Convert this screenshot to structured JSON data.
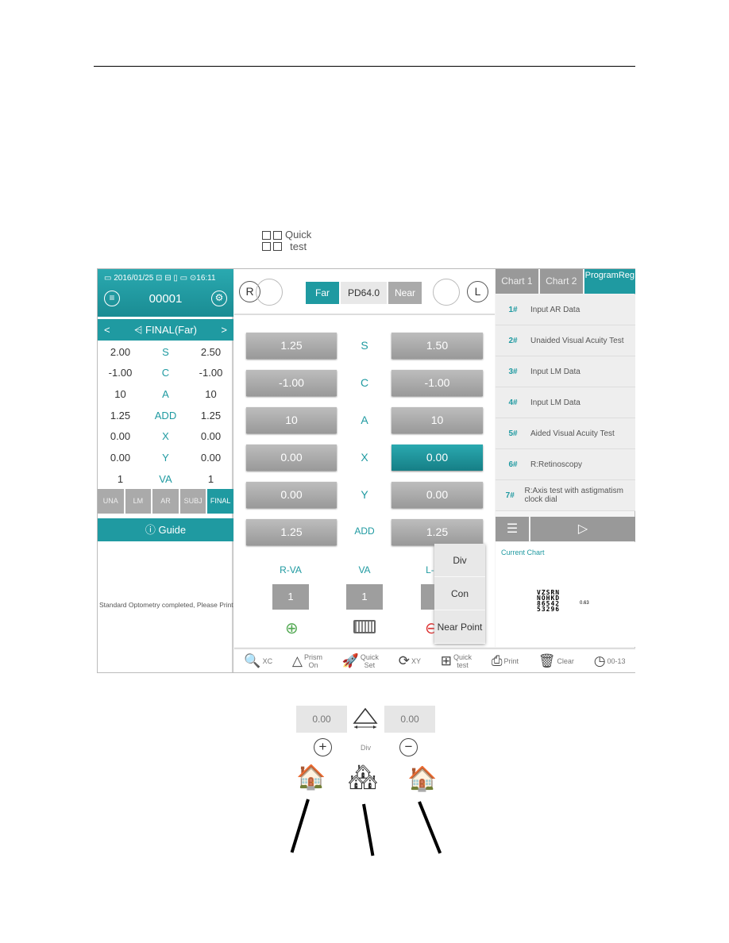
{
  "quick_test_icon": {
    "icon": "quick-test-grid-icon",
    "line1": "Quick",
    "line2": "test"
  },
  "app": {
    "status": "▭ 2016/01/25 ⊡ ⊟ ▯ ▭ ⊙16:11",
    "patient_id": "00001",
    "nav_title": "FINAL(Far)",
    "nav_prev": "<",
    "nav_next": ">",
    "summary": [
      {
        "r": "2.00",
        "label": "S",
        "l": "2.50"
      },
      {
        "r": "-1.00",
        "label": "C",
        "l": "-1.00"
      },
      {
        "r": "10",
        "label": "A",
        "l": "10"
      },
      {
        "r": "1.25",
        "label": "ADD",
        "l": "1.25"
      },
      {
        "r": "0.00",
        "label": "X",
        "l": "0.00"
      },
      {
        "r": "0.00",
        "label": "Y",
        "l": "0.00"
      },
      {
        "r": "1",
        "label": "VA",
        "l": "1"
      }
    ],
    "mode_tabs": [
      "UNA",
      "LM",
      "AR",
      "SUBJ",
      "FINAL"
    ],
    "active_mode": "FINAL",
    "guide": "Guide",
    "message": "Standard Optometry completed, Please Print",
    "top": {
      "r": "R",
      "l": "L",
      "far": "Far",
      "pd": "PD64.0",
      "near": "Near"
    },
    "rows": [
      {
        "r": "1.25",
        "label": "S",
        "l": "1.50"
      },
      {
        "r": "-1.00",
        "label": "C",
        "l": "-1.00"
      },
      {
        "r": "10",
        "label": "A",
        "l": "10"
      },
      {
        "r": "0.00",
        "label": "X",
        "l": "0.00"
      },
      {
        "r": "0.00",
        "label": "Y",
        "l": "0.00"
      },
      {
        "r": "1.25",
        "label": "ADD",
        "l": "1.25"
      }
    ],
    "va": {
      "r_label": "R-VA",
      "label": "VA",
      "l_label": "L-VA",
      "r": "1",
      "both": "1",
      "l": "1"
    },
    "popup": [
      "Div",
      "Con",
      "Near Point"
    ],
    "chart_tabs": [
      "Chart 1",
      "Chart 2",
      "ProgramReg"
    ],
    "program": [
      {
        "n": "1#",
        "t": "Input AR Data"
      },
      {
        "n": "2#",
        "t": "Unaided Visual Acuity Test"
      },
      {
        "n": "3#",
        "t": "Input LM Data"
      },
      {
        "n": "4#",
        "t": "Input LM Data"
      },
      {
        "n": "5#",
        "t": "Aided Visual Acuity Test"
      },
      {
        "n": "6#",
        "t": "R:Retinoscopy"
      },
      {
        "n": "7#",
        "t": "R:Axis test with astigmatism clock dial"
      }
    ],
    "current_chart": "Current Chart",
    "chart_rows": [
      "VZSRN",
      "NOHKD",
      "86542",
      "53296"
    ],
    "chart_value": "0.63",
    "toolbar": [
      {
        "icon": "search-icon",
        "a": "XC",
        "b": ""
      },
      {
        "icon": "prism-icon",
        "a": "Prism",
        "b": "On"
      },
      {
        "icon": "rocket-icon",
        "a": "Quick",
        "b": "Set"
      },
      {
        "icon": "refresh-icon",
        "a": "XY",
        "b": ""
      },
      {
        "icon": "quick-test-grid-icon",
        "a": "Quick",
        "b": "test"
      },
      {
        "icon": "print-icon",
        "a": "Print",
        "b": ""
      },
      {
        "icon": "trash-icon",
        "a": "Clear",
        "b": ""
      },
      {
        "icon": "clock-icon",
        "a": "00-13",
        "b": ""
      }
    ]
  },
  "prism": {
    "left": "0.00",
    "right": "0.00",
    "label": "Div"
  },
  "colors": {
    "teal": "#1f9aa1",
    "gray_button": "#aaaaaa"
  }
}
